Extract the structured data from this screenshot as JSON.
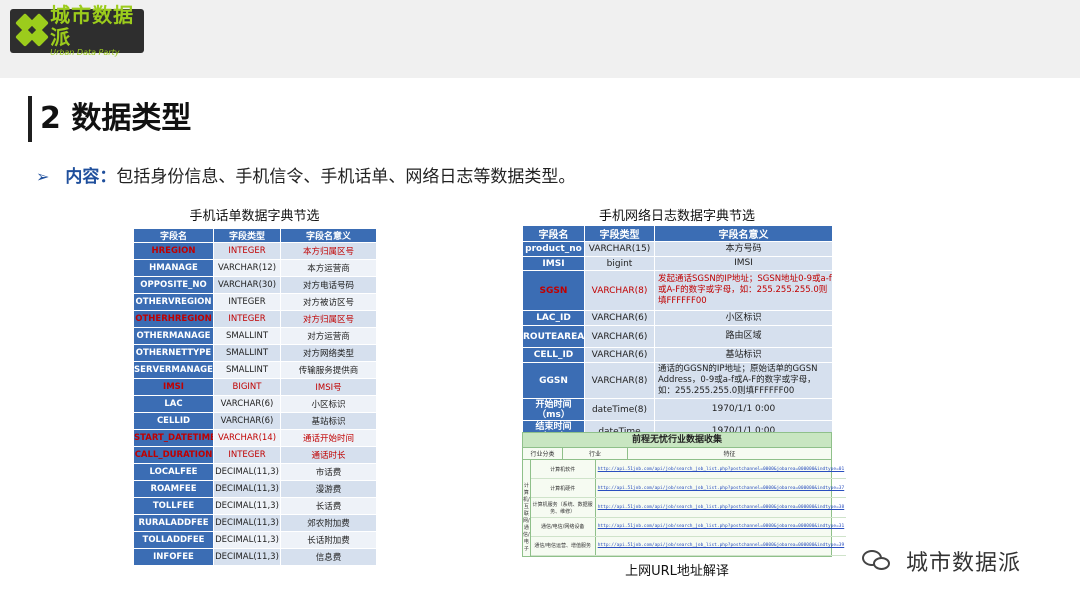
{
  "brand": {
    "logo_cn": "城市数据派",
    "logo_en": "Urban Data Party"
  },
  "slide": {
    "title": "2 数据类型",
    "bullet_marker": "➢",
    "bullet_label": "内容：",
    "bullet_text": "包括身份信息、手机信令、手机话单、网络日志等数据类型。"
  },
  "left_table": {
    "caption": "手机话单数据字典节选",
    "headers": [
      "字段名",
      "字段类型",
      "字段名意义"
    ],
    "rows": [
      {
        "name": "HREGION",
        "type": "INTEGER",
        "meaning": "本方归属区号",
        "hl": true
      },
      {
        "name": "HMANAGE",
        "type": "VARCHAR(12)",
        "meaning": "本方运营商",
        "hl": false
      },
      {
        "name": "OPPOSITE_NO",
        "type": "VARCHAR(30)",
        "meaning": "对方电话号码",
        "hl": false
      },
      {
        "name": "OTHERVREGION",
        "type": "INTEGER",
        "meaning": "对方被访区号",
        "hl": false
      },
      {
        "name": "OTHERHREGION",
        "type": "INTEGER",
        "meaning": "对方归属区号",
        "hl": true
      },
      {
        "name": "OTHERMANAGE",
        "type": "SMALLINT",
        "meaning": "对方运营商",
        "hl": false
      },
      {
        "name": "OTHERNETTYPE",
        "type": "SMALLINT",
        "meaning": "对方网络类型",
        "hl": false
      },
      {
        "name": "SERVERMANAGE",
        "type": "SMALLINT",
        "meaning": "传输服务提供商",
        "hl": false
      },
      {
        "name": "IMSI",
        "type": "BIGINT",
        "meaning": "IMSI号",
        "hl": true
      },
      {
        "name": "LAC",
        "type": "VARCHAR(6)",
        "meaning": "小区标识",
        "hl": false
      },
      {
        "name": "CELLID",
        "type": "VARCHAR(6)",
        "meaning": "基站标识",
        "hl": false
      },
      {
        "name": "START_DATETIME",
        "type": "VARCHAR(14)",
        "meaning": "通话开始时间",
        "hl": true
      },
      {
        "name": "CALL_DURATION",
        "type": "INTEGER",
        "meaning": "通话时长",
        "hl": true
      },
      {
        "name": "LOCALFEE",
        "type": "DECIMAL(11,3)",
        "meaning": "市话费",
        "hl": false
      },
      {
        "name": "ROAMFEE",
        "type": "DECIMAL(11,3)",
        "meaning": "漫游费",
        "hl": false
      },
      {
        "name": "TOLLFEE",
        "type": "DECIMAL(11,3)",
        "meaning": "长话费",
        "hl": false
      },
      {
        "name": "RURALADDFEE",
        "type": "DECIMAL(11,3)",
        "meaning": "郊农附加费",
        "hl": false
      },
      {
        "name": "TOLLADDFEE",
        "type": "DECIMAL(11,3)",
        "meaning": "长话附加费",
        "hl": false
      },
      {
        "name": "INFOFEE",
        "type": "DECIMAL(11,3)",
        "meaning": "信息费",
        "hl": false
      }
    ]
  },
  "right_table": {
    "caption": "手机网络日志数据字典节选",
    "headers": [
      "字段名",
      "字段类型",
      "字段名意义"
    ],
    "rows": [
      {
        "name": "product_no",
        "type": "VARCHAR(15)",
        "meaning": "本方号码",
        "hl": false,
        "left": false
      },
      {
        "name": "IMSI",
        "type": "bigint",
        "meaning": "IMSI",
        "hl": false,
        "left": false
      },
      {
        "name": "SGSN",
        "type": "VARCHAR(8)",
        "meaning": "发起通话SGSN的IP地址；SGSN地址0-9或a-f或A-F的数字或字母，如：255.255.255.0则填FFFFFF00",
        "hl": true,
        "left": true
      },
      {
        "name": "LAC_ID",
        "type": "VARCHAR(6)",
        "meaning": "小区标识",
        "hl": false,
        "left": false
      },
      {
        "name": "ROUTEAREA",
        "type": "VARCHAR(6)",
        "meaning": "路由区域",
        "hl": false,
        "left": false
      },
      {
        "name": "CELL_ID",
        "type": "VARCHAR(6)",
        "meaning": "基站标识",
        "hl": false,
        "left": false
      },
      {
        "name": "GGSN",
        "type": "VARCHAR(8)",
        "meaning": "通话的GGSN的IP地址；原始话单的GGSN Address，0-9或a-f或A-F的数字或字母，如：255.255.255.0则填FFFFFF00",
        "hl": false,
        "left": true
      },
      {
        "name": "开始时间（ms）",
        "type": "dateTime(8)",
        "meaning": "1970/1/1 0:00",
        "hl": false,
        "left": false
      },
      {
        "name": "结束时间（ms）",
        "type": "dateTime",
        "meaning": "1970/1/1 0:00",
        "hl": false,
        "left": false
      }
    ]
  },
  "url_panel": {
    "title": "前程无忧行业数据收集",
    "headers": [
      "行业分类",
      "行业",
      "特征"
    ],
    "category": "计算机/互联网/通信/电子",
    "rows": [
      {
        "industry": "计算机软件",
        "url": "http://api.51job.com/api/job/search_job_list.php?postchannel=0000&jobarea=000000&indtype=01"
      },
      {
        "industry": "计算机硬件",
        "url": "http://api.51job.com/api/job/search_job_list.php?postchannel=0000&jobarea=000000&indtype=37"
      },
      {
        "industry": "计算机服务（系统、数据服务、维修）",
        "url": "http://api.51job.com/api/job/search_job_list.php?postchannel=0000&jobarea=000000&indtype=38"
      },
      {
        "industry": "通信/电信/网络设备",
        "url": "http://api.51job.com/api/job/search_job_list.php?postchannel=0000&jobarea=000000&indtype=31"
      },
      {
        "industry": "通信/电信运营、增值服务",
        "url": "http://api.51job.com/api/job/search_job_list.php?postchannel=0000&jobarea=000000&indtype=39"
      }
    ],
    "caption": "上网URL地址解译"
  },
  "footer": {
    "brand": "城市数据派"
  }
}
